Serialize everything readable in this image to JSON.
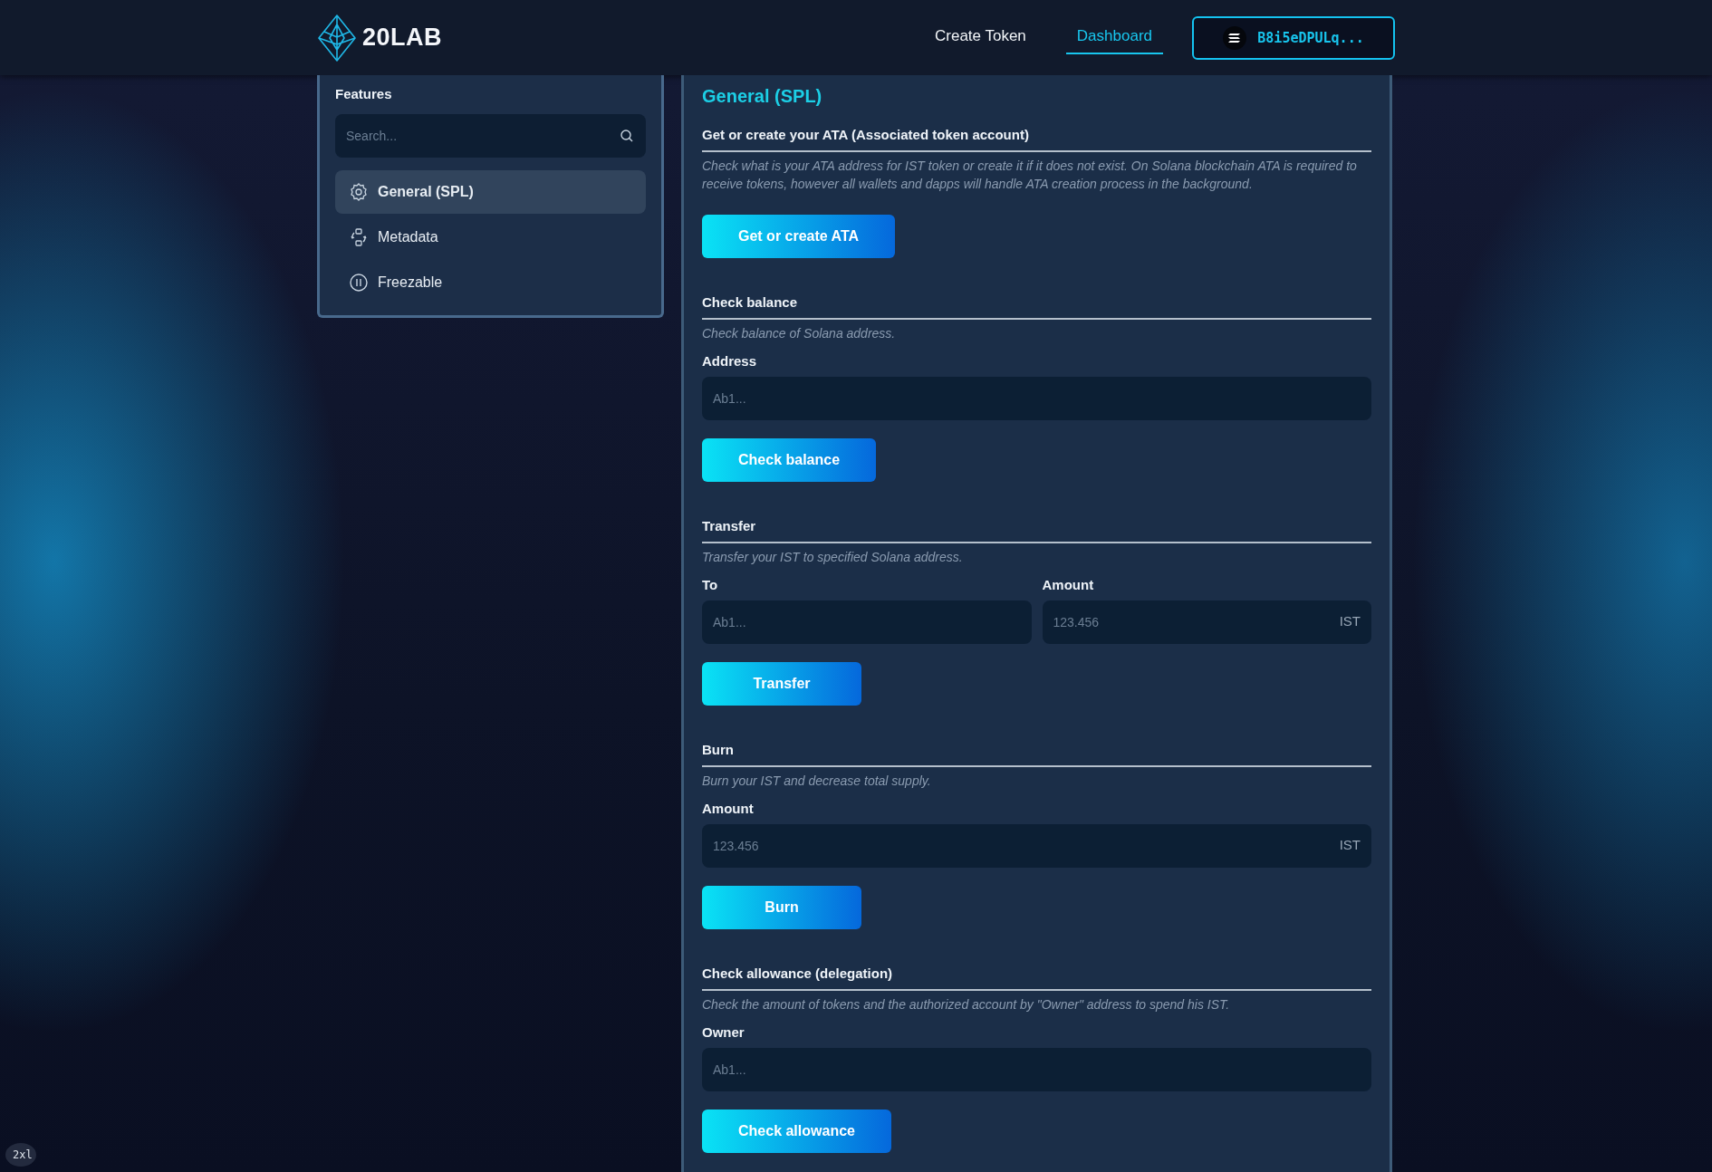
{
  "header": {
    "logo_text": "20LAB",
    "nav": [
      {
        "label": "Create Token",
        "selected": false
      },
      {
        "label": "Dashboard",
        "selected": true
      }
    ],
    "wallet_button": "B8i5eDPULq..."
  },
  "sidebar": {
    "title": "Features",
    "search": {
      "placeholder": "Search..."
    },
    "items": [
      {
        "label": "General (SPL)",
        "selected": true
      },
      {
        "label": "Metadata",
        "selected": false
      },
      {
        "label": "Freezable",
        "selected": false
      }
    ]
  },
  "main": {
    "title": "General (SPL)",
    "sections": [
      {
        "title": "Get or create your ATA (Associated token account)",
        "description": "Check what is your ATA address for IST token or create it if it does not exist. On Solana blockchain ATA is required to receive tokens, however all wallets and dapps will handle ATA creation process in the background.",
        "button": "Get or create ATA"
      },
      {
        "title": "Check balance",
        "description": "Check balance of Solana address.",
        "fields": [
          {
            "label": "Address",
            "placeholder": "Ab1..."
          }
        ],
        "button": "Check balance"
      },
      {
        "title": "Transfer",
        "description": "Transfer your IST to specified Solana address.",
        "fields": [
          {
            "label": "To",
            "placeholder": "Ab1..."
          },
          {
            "label": "Amount",
            "placeholder": "123.456",
            "suffix": "IST"
          }
        ],
        "button": "Transfer"
      },
      {
        "title": "Burn",
        "description": "Burn your IST and decrease total supply.",
        "fields": [
          {
            "label": "Amount",
            "placeholder": "123.456",
            "suffix": "IST"
          }
        ],
        "button": "Burn"
      },
      {
        "title": "Check allowance (delegation)",
        "description": "Check the amount of tokens and the authorized account by \"Owner\" address to spend his IST.",
        "fields": [
          {
            "label": "Owner",
            "placeholder": "Ab1..."
          }
        ],
        "button": "Check allowance"
      }
    ]
  },
  "breakpoint_badge": "2xl"
}
